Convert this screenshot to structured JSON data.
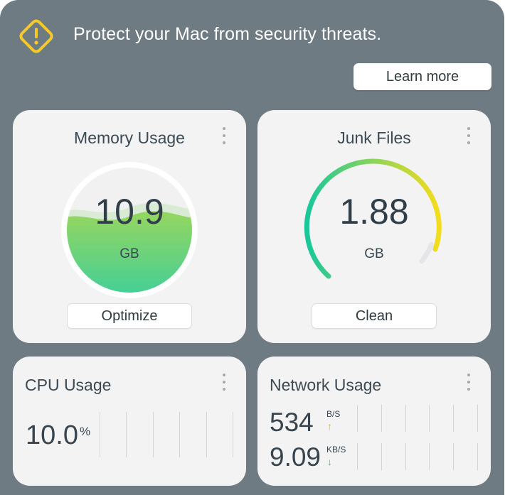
{
  "banner": {
    "text": "Protect your Mac from security threats.",
    "button_label": "Learn more",
    "icon": "warning-icon",
    "icon_color": "#f5c928"
  },
  "memory": {
    "title": "Memory Usage",
    "value": "10.9",
    "unit": "GB",
    "button_label": "Optimize",
    "gauge_colors": [
      "#96d65f",
      "#3fcf9a"
    ]
  },
  "junk": {
    "title": "Junk Files",
    "value": "1.88",
    "unit": "GB",
    "button_label": "Clean",
    "gauge_colors": [
      "#18c79a",
      "#f5dc1a"
    ]
  },
  "cpu": {
    "title": "CPU Usage",
    "value": "10.0",
    "unit": "%"
  },
  "network": {
    "title": "Network Usage",
    "upload_value": "534",
    "upload_unit": "B/S",
    "download_value": "9.09",
    "download_unit": "KB/S",
    "upload_arrow_color": "#f4b400",
    "download_arrow_color": "#35c27a"
  }
}
